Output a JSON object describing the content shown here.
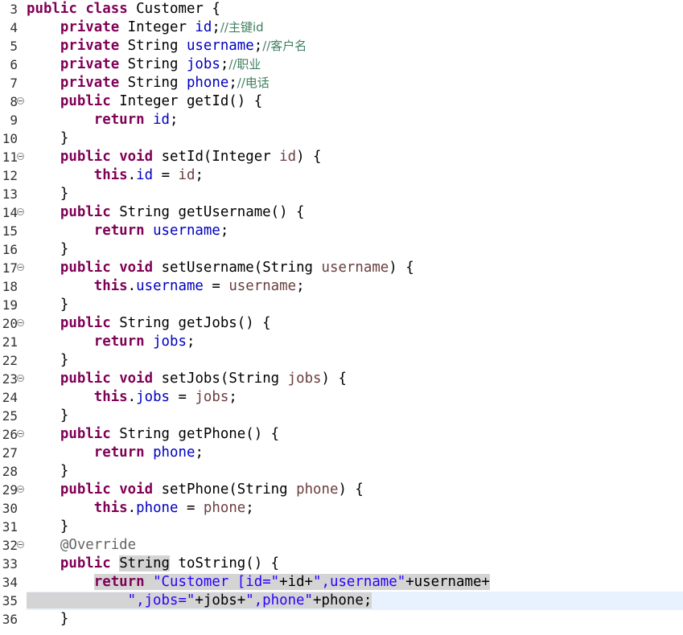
{
  "editor": {
    "lines": [
      {
        "num": "3",
        "fold": false,
        "tokens": [
          [
            "kw",
            "public"
          ],
          [
            "p",
            " "
          ],
          [
            "kw",
            "class"
          ],
          [
            "p",
            " Customer {"
          ]
        ]
      },
      {
        "num": "4",
        "fold": false,
        "tokens": [
          [
            "p",
            "    "
          ],
          [
            "kw",
            "private"
          ],
          [
            "p",
            " Integer "
          ],
          [
            "fld",
            "id"
          ],
          [
            "p",
            ";"
          ],
          [
            "com",
            "//主键id"
          ]
        ]
      },
      {
        "num": "5",
        "fold": false,
        "tokens": [
          [
            "p",
            "    "
          ],
          [
            "kw",
            "private"
          ],
          [
            "p",
            " String "
          ],
          [
            "fld",
            "username"
          ],
          [
            "p",
            ";"
          ],
          [
            "com",
            "//客户名"
          ]
        ]
      },
      {
        "num": "6",
        "fold": false,
        "tokens": [
          [
            "p",
            "    "
          ],
          [
            "kw",
            "private"
          ],
          [
            "p",
            " String "
          ],
          [
            "fld",
            "jobs"
          ],
          [
            "p",
            ";"
          ],
          [
            "com",
            "//职业"
          ]
        ]
      },
      {
        "num": "7",
        "fold": false,
        "tokens": [
          [
            "p",
            "    "
          ],
          [
            "kw",
            "private"
          ],
          [
            "p",
            " String "
          ],
          [
            "fld",
            "phone"
          ],
          [
            "p",
            ";"
          ],
          [
            "com",
            "//电话"
          ]
        ]
      },
      {
        "num": "8",
        "fold": true,
        "tokens": [
          [
            "p",
            "    "
          ],
          [
            "kw",
            "public"
          ],
          [
            "p",
            " Integer getId() {"
          ]
        ]
      },
      {
        "num": "9",
        "fold": false,
        "tokens": [
          [
            "p",
            "        "
          ],
          [
            "kw",
            "return"
          ],
          [
            "p",
            " "
          ],
          [
            "fld",
            "id"
          ],
          [
            "p",
            ";"
          ]
        ]
      },
      {
        "num": "10",
        "fold": false,
        "tokens": [
          [
            "p",
            "    }"
          ]
        ]
      },
      {
        "num": "11",
        "fold": true,
        "tokens": [
          [
            "p",
            "    "
          ],
          [
            "kw",
            "public"
          ],
          [
            "p",
            " "
          ],
          [
            "kw",
            "void"
          ],
          [
            "p",
            " setId(Integer "
          ],
          [
            "par",
            "id"
          ],
          [
            "p",
            ") {"
          ]
        ]
      },
      {
        "num": "12",
        "fold": false,
        "tokens": [
          [
            "p",
            "        "
          ],
          [
            "kw",
            "this"
          ],
          [
            "p",
            "."
          ],
          [
            "fld",
            "id"
          ],
          [
            "p",
            " = "
          ],
          [
            "par",
            "id"
          ],
          [
            "p",
            ";"
          ]
        ]
      },
      {
        "num": "13",
        "fold": false,
        "tokens": [
          [
            "p",
            "    }"
          ]
        ]
      },
      {
        "num": "14",
        "fold": true,
        "tokens": [
          [
            "p",
            "    "
          ],
          [
            "kw",
            "public"
          ],
          [
            "p",
            " String getUsername() {"
          ]
        ]
      },
      {
        "num": "15",
        "fold": false,
        "tokens": [
          [
            "p",
            "        "
          ],
          [
            "kw",
            "return"
          ],
          [
            "p",
            " "
          ],
          [
            "fld",
            "username"
          ],
          [
            "p",
            ";"
          ]
        ]
      },
      {
        "num": "16",
        "fold": false,
        "tokens": [
          [
            "p",
            "    }"
          ]
        ]
      },
      {
        "num": "17",
        "fold": true,
        "tokens": [
          [
            "p",
            "    "
          ],
          [
            "kw",
            "public"
          ],
          [
            "p",
            " "
          ],
          [
            "kw",
            "void"
          ],
          [
            "p",
            " setUsername(String "
          ],
          [
            "par",
            "username"
          ],
          [
            "p",
            ") {"
          ]
        ]
      },
      {
        "num": "18",
        "fold": false,
        "tokens": [
          [
            "p",
            "        "
          ],
          [
            "kw",
            "this"
          ],
          [
            "p",
            "."
          ],
          [
            "fld",
            "username"
          ],
          [
            "p",
            " = "
          ],
          [
            "par",
            "username"
          ],
          [
            "p",
            ";"
          ]
        ]
      },
      {
        "num": "19",
        "fold": false,
        "tokens": [
          [
            "p",
            "    }"
          ]
        ]
      },
      {
        "num": "20",
        "fold": true,
        "tokens": [
          [
            "p",
            "    "
          ],
          [
            "kw",
            "public"
          ],
          [
            "p",
            " String getJobs() {"
          ]
        ]
      },
      {
        "num": "21",
        "fold": false,
        "tokens": [
          [
            "p",
            "        "
          ],
          [
            "kw",
            "return"
          ],
          [
            "p",
            " "
          ],
          [
            "fld",
            "jobs"
          ],
          [
            "p",
            ";"
          ]
        ]
      },
      {
        "num": "22",
        "fold": false,
        "tokens": [
          [
            "p",
            "    }"
          ]
        ]
      },
      {
        "num": "23",
        "fold": true,
        "tokens": [
          [
            "p",
            "    "
          ],
          [
            "kw",
            "public"
          ],
          [
            "p",
            " "
          ],
          [
            "kw",
            "void"
          ],
          [
            "p",
            " setJobs(String "
          ],
          [
            "par",
            "jobs"
          ],
          [
            "p",
            ") {"
          ]
        ]
      },
      {
        "num": "24",
        "fold": false,
        "tokens": [
          [
            "p",
            "        "
          ],
          [
            "kw",
            "this"
          ],
          [
            "p",
            "."
          ],
          [
            "fld",
            "jobs"
          ],
          [
            "p",
            " = "
          ],
          [
            "par",
            "jobs"
          ],
          [
            "p",
            ";"
          ]
        ]
      },
      {
        "num": "25",
        "fold": false,
        "tokens": [
          [
            "p",
            "    }"
          ]
        ]
      },
      {
        "num": "26",
        "fold": true,
        "tokens": [
          [
            "p",
            "    "
          ],
          [
            "kw",
            "public"
          ],
          [
            "p",
            " String getPhone() {"
          ]
        ]
      },
      {
        "num": "27",
        "fold": false,
        "tokens": [
          [
            "p",
            "        "
          ],
          [
            "kw",
            "return"
          ],
          [
            "p",
            " "
          ],
          [
            "fld",
            "phone"
          ],
          [
            "p",
            ";"
          ]
        ]
      },
      {
        "num": "28",
        "fold": false,
        "tokens": [
          [
            "p",
            "    }"
          ]
        ]
      },
      {
        "num": "29",
        "fold": true,
        "tokens": [
          [
            "p",
            "    "
          ],
          [
            "kw",
            "public"
          ],
          [
            "p",
            " "
          ],
          [
            "kw",
            "void"
          ],
          [
            "p",
            " setPhone(String "
          ],
          [
            "par",
            "phone"
          ],
          [
            "p",
            ") {"
          ]
        ]
      },
      {
        "num": "30",
        "fold": false,
        "tokens": [
          [
            "p",
            "        "
          ],
          [
            "kw",
            "this"
          ],
          [
            "p",
            "."
          ],
          [
            "fld",
            "phone"
          ],
          [
            "p",
            " = "
          ],
          [
            "par",
            "phone"
          ],
          [
            "p",
            ";"
          ]
        ]
      },
      {
        "num": "31",
        "fold": false,
        "tokens": [
          [
            "p",
            "    }"
          ]
        ]
      },
      {
        "num": "32",
        "fold": true,
        "tokens": [
          [
            "p",
            "    "
          ],
          [
            "ann",
            "@Override"
          ]
        ]
      },
      {
        "num": "33",
        "fold": false,
        "tokens": [
          [
            "p",
            "    "
          ],
          [
            "kw",
            "public"
          ],
          [
            "p",
            " "
          ],
          [
            "p sel",
            "String"
          ],
          [
            "p",
            " toString() {"
          ]
        ]
      },
      {
        "num": "34",
        "fold": false,
        "tokens": [
          [
            "p",
            "        "
          ],
          [
            "kw sel",
            "return"
          ],
          [
            "p sel",
            " "
          ],
          [
            "str sel",
            "\"Customer [id=\""
          ],
          [
            "p sel",
            "+id+"
          ],
          [
            "str sel",
            "\",username\""
          ],
          [
            "p sel",
            "+username+"
          ]
        ]
      },
      {
        "num": "35",
        "fold": false,
        "current": true,
        "tokens": [
          [
            "p sel",
            "            "
          ],
          [
            "str sel",
            "\",jobs=\""
          ],
          [
            "p sel",
            "+jobs+"
          ],
          [
            "str sel",
            "\",phone\""
          ],
          [
            "p sel",
            "+phone;"
          ]
        ]
      },
      {
        "num": "36",
        "fold": false,
        "tokens": [
          [
            "p",
            "    }"
          ]
        ]
      }
    ]
  }
}
